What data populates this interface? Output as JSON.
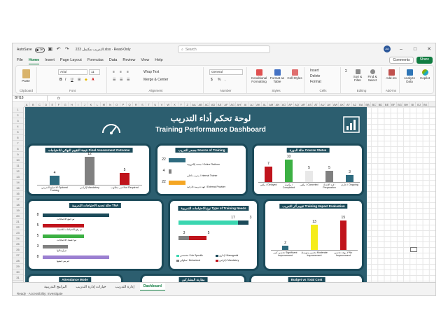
{
  "titlebar": {
    "autosave": "AutoSave",
    "toggle": "Off",
    "doc_title": "التدريب مكتمل 223.xlsx  ·  Read-Only",
    "search_placeholder": "Search",
    "avatar": "AA"
  },
  "menu": {
    "items": [
      "File",
      "Home",
      "Insert",
      "Page Layout",
      "Formulas",
      "Data",
      "Review",
      "View",
      "Help"
    ],
    "comments": "Comments",
    "share": "Share"
  },
  "ribbon": {
    "paste": "Paste",
    "clipboard": "Clipboard",
    "font_name": "Arial",
    "font_size": "11",
    "font": "Font",
    "wrap": "Wrap Text",
    "merge": "Merge & Center",
    "alignment": "Alignment",
    "number_format": "General",
    "number": "Number",
    "cond_format": "Conditional Formatting",
    "format_table": "Format as Table",
    "cell_styles": "Cell Styles",
    "styles": "Styles",
    "insert": "Insert",
    "delete": "Delete",
    "format": "Format",
    "cells": "Cells",
    "sort": "Sort & Filter",
    "find": "Find & Select",
    "editing": "Editing",
    "addins": "Add-ins",
    "addins_group": "Add-ins",
    "analyze": "Analyze Data",
    "copilot": "Copilot"
  },
  "formula": {
    "namebox": "BH18",
    "fx": "fx"
  },
  "columns": [
    "A",
    "B",
    "C",
    "D",
    "E",
    "F",
    "G",
    "H",
    "I",
    "J",
    "K",
    "L",
    "M",
    "N",
    "O",
    "P",
    "Q",
    "R",
    "S",
    "T",
    "U",
    "V",
    "W",
    "X",
    "Y",
    "Z",
    "AA",
    "AB",
    "AC",
    "AD",
    "AE",
    "AF",
    "AG",
    "AH",
    "AI",
    "AJ",
    "AK",
    "AL",
    "AM",
    "AN",
    "AO",
    "AP",
    "AQ",
    "AR",
    "AS",
    "AT",
    "AU",
    "AV",
    "AW",
    "AX",
    "AY",
    "AZ",
    "BA",
    "BB",
    "BC",
    "BD",
    "BE",
    "BF",
    "BG",
    "BH",
    "BI",
    "BJ",
    "BK"
  ],
  "rows": [
    "1",
    "2",
    "3",
    "4",
    "5",
    "6",
    "7",
    "8",
    "9",
    "10",
    "11",
    "12",
    "13",
    "14",
    "15",
    "16",
    "17",
    "18",
    "19",
    "20",
    "21",
    "22",
    "23",
    "24",
    "25",
    "26",
    "27",
    "28",
    "29",
    "30",
    "31"
  ],
  "dashboard": {
    "title_ar": "لوحة تحكم أداء التدريب",
    "title_en": "Training Performance Dashboard"
  },
  "colors": {
    "navy": "#1b4a59",
    "teal": "#2e6b7f",
    "gray": "#808080",
    "red": "#c0141c",
    "green": "#3cb043",
    "yellow": "#f5ec1a",
    "orange": "#f5a623",
    "purple": "#9b7fd1",
    "light_teal": "#3ad6b0",
    "light_gray": "#e8e8e8"
  },
  "chart_data": [
    {
      "type": "bar",
      "title": "نتيجة التقييم النهائي للاحتياجات Final Assessment Outcome",
      "categories": [
        "الاحتياج التدريبي Optional Training",
        "إلزامي Mandatory",
        "غير مطلوب Not Required"
      ],
      "values": [
        4,
        12,
        5
      ]
    },
    {
      "type": "bar",
      "orientation": "horizontal",
      "title": "مصدر التدريب Source of Training",
      "categories": [
        "منصة إلكترونية / Online Platform",
        "مدرب داخلي / Internal Trainer",
        "جهة تدريبية خارجية / External Provider"
      ],
      "values": [
        22,
        4,
        22
      ]
    },
    {
      "type": "bar",
      "title": "حالة الدورة Course Status",
      "categories": [
        "ملغي / Delayed",
        "مكتمل / Completed",
        "ملغى / Canceled",
        "قيد الإعداد / Preparation",
        "جاري / Ongoing"
      ],
      "values": [
        7,
        10,
        5,
        5,
        3
      ]
    },
    {
      "type": "bar",
      "orientation": "horizontal",
      "title": "حالة تحديد الاحتياجات التدريبية TNA",
      "categories": [
        "تم جمع الاحتياجات",
        "تم رفع الاحتياجات للاعتماد",
        "تم اعتماد الاحتياجات",
        "تم إرسالها",
        "لم يتم جمعها"
      ],
      "values": [
        8,
        5,
        5,
        3,
        8
      ]
    },
    {
      "type": "bar",
      "orientation": "horizontal",
      "title": "نوع الاحتياجات التدريبية Type of Training Needs",
      "series": [
        {
          "name": "تخصصي / Job Specific",
          "values": [
            17
          ]
        },
        {
          "name": "إداري / Managerial",
          "values": [
            3
          ]
        },
        {
          "name": "سلوكي / Behavioral",
          "values": [
            3
          ]
        },
        {
          "name": "إلزامي / Mandatory",
          "values": [
            5
          ]
        }
      ]
    },
    {
      "type": "bar",
      "title": "تقييم أثر التدريب Training Impact Evaluation",
      "categories": [
        "تحسن كبير Significant Improvement",
        "تحسن متوسط Moderate Improvement",
        "لا يوجد تحسن No Improvement"
      ],
      "values": [
        2,
        13,
        15
      ]
    }
  ],
  "bottom_panels": {
    "attendance": "Attendance Mode",
    "participants": "مقارنة المشاركين",
    "budget": "Budget vs Total Cost"
  },
  "sheets": [
    "البرامج التدريبية",
    "خيارات إدارة التدريب",
    "إدارة التدريب",
    "Dashboard"
  ],
  "status": "Ready  ·  Accessibility: Investigate"
}
